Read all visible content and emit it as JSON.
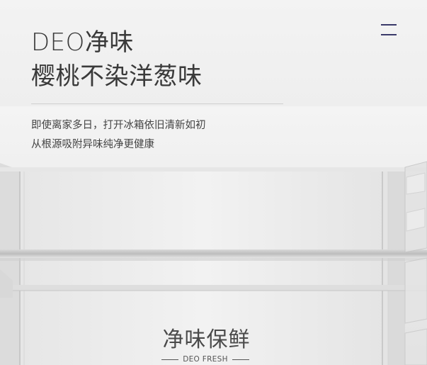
{
  "header": {
    "menu_icon": "hamburger-menu-icon",
    "menu_color": "#3a3a6a"
  },
  "hero": {
    "title_line1": "DEO净味",
    "title_line2": "樱桃不染洋葱味",
    "description_line1": "即使离家多日，打开冰箱依旧清新如初",
    "description_line2": "从根源吸附异味纯净更健康"
  },
  "feature_badge": {
    "title": "净味保鲜",
    "subtitle": "DEO FRESH"
  },
  "colors": {
    "text": "#3a3a3a",
    "background": "#ececec"
  }
}
